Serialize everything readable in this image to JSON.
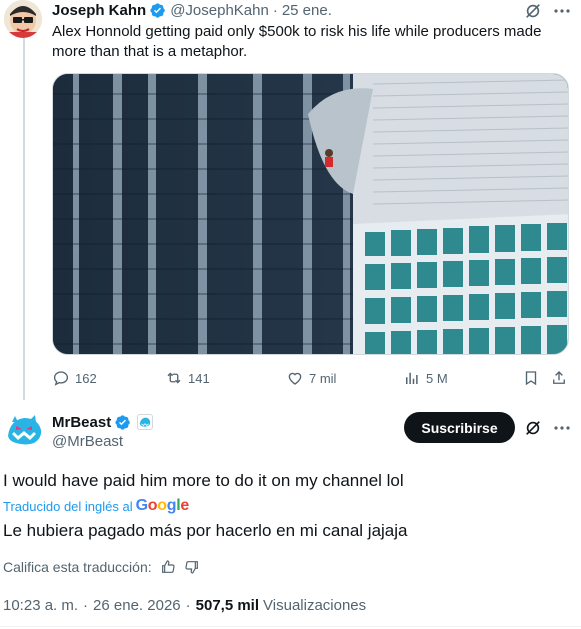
{
  "parent_tweet": {
    "author_name": "Joseph Kahn",
    "handle": "@JosephKahn",
    "separator": "·",
    "date": "25 ene.",
    "text": "Alex Honnold getting paid only $500k to risk his life while producers made more than that is a metaphor.",
    "media_icon": "image-skyscraper-climber",
    "stats": {
      "replies": "162",
      "reposts": "141",
      "likes": "7 mil",
      "views": "5 M"
    }
  },
  "reply_tweet": {
    "author_name": "MrBeast",
    "handle": "@MrBeast",
    "subscribe_label": "Suscribirse",
    "text": "I would have paid him more to do it on my channel lol",
    "translated_by_label": "Traducido del inglés al",
    "translator_brand": "Google",
    "translation": "Le hubiera pagado más por hacerlo en mi canal jajaja",
    "rate_translation_label": "Califica esta traducción:",
    "time": "10:23 a. m.",
    "separator": "·",
    "date": "26 ene. 2026",
    "views_count": "507,5 mil",
    "views_label": "Visualizaciones"
  },
  "colors": {
    "verified_blue": "#1d9bf0",
    "text_primary": "#0f1419",
    "text_secondary": "#536471",
    "button_dark": "#0f1419",
    "link_blue": "#1d9bf0"
  }
}
